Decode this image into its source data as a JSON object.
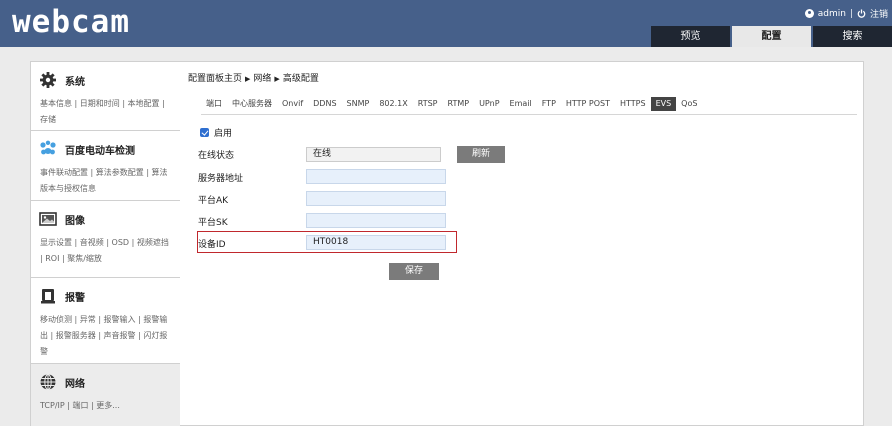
{
  "header": {
    "logo": "webcam",
    "user": "admin",
    "separator": "|",
    "logout": "注销",
    "tabs": [
      "预览",
      "配置",
      "搜索"
    ],
    "active_tab": "配置"
  },
  "sidebar": {
    "sections": [
      {
        "title": "系统",
        "icon": "gear-icon",
        "links": "基本信息 | 日期和时间 | 本地配置 | 存储"
      },
      {
        "title": "百度电动车检测",
        "icon": "cluster-icon",
        "links": "事件联动配置 | 算法参数配置 | 算法版本与授权信息"
      },
      {
        "title": "图像",
        "icon": "image-icon",
        "links": "显示设置 | 音视频 | OSD | 视频遮挡 | ROI | 聚焦/缩放"
      },
      {
        "title": "报警",
        "icon": "alarm-icon",
        "links": "移动侦测 | 异常 | 报警输入 | 报警输出 | 报警服务器 | 声音报警 | 闪灯报警"
      },
      {
        "title": "网络",
        "icon": "globe-icon",
        "links": "TCP/IP | 端口 | 更多..."
      }
    ]
  },
  "content": {
    "breadcrumb": [
      "配置面板主页",
      "网络",
      "高级配置"
    ],
    "breadcrumb_arrow": "▶",
    "subtabs": [
      "端口",
      "中心服务器",
      "Onvif",
      "DDNS",
      "SNMP",
      "802.1X",
      "RTSP",
      "RTMP",
      "UPnP",
      "Email",
      "FTP",
      "HTTP POST",
      "HTTPS",
      "EVS",
      "QoS"
    ],
    "active_subtab": "EVS",
    "enable_label": "启用",
    "enable_checked": true,
    "rows": {
      "status_label": "在线状态",
      "status_value": "在线",
      "refresh_button": "刷新",
      "server_label": "服务器地址",
      "server_value": "",
      "ak_label": "平台AK",
      "ak_value": "",
      "sk_label": "平台SK",
      "sk_value": "",
      "device_label": "设备ID",
      "device_value": "HT0018"
    },
    "save_button": "保存"
  },
  "colors": {
    "header_bg": "#46608a",
    "tab_bg": "#1f2632",
    "active_tab_bg": "#e8e8e8",
    "field_bg": "#e7f0fb",
    "highlight_border": "#c0282d",
    "button_bg": "#7b7b7b"
  }
}
